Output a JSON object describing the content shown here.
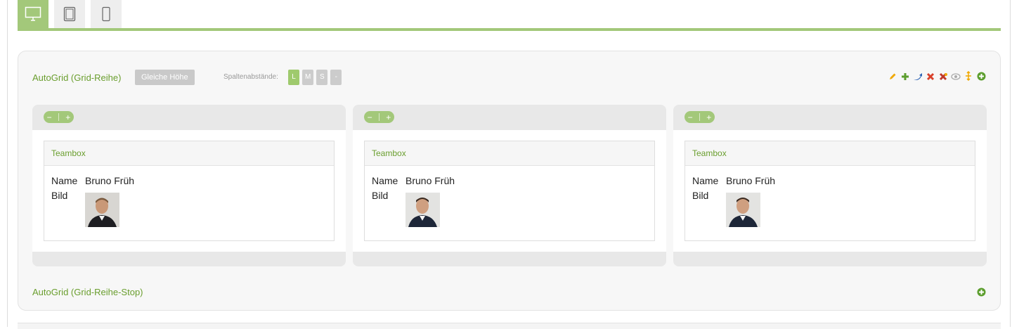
{
  "device_tabs": [
    {
      "name": "desktop-icon",
      "active": true
    },
    {
      "name": "tablet-icon",
      "active": false
    },
    {
      "name": "mobile-icon",
      "active": false
    }
  ],
  "autogrid": {
    "title": "AutoGrid (Grid-Reihe)",
    "equal_height_label": "Gleiche Höhe",
    "gap_label": "Spaltenabstände:",
    "gap_options": [
      {
        "label": "L",
        "active": true
      },
      {
        "label": "M",
        "active": false
      },
      {
        "label": "S",
        "active": false
      },
      {
        "label": "-",
        "active": false
      }
    ],
    "toolbar_icons": [
      "pencil-icon",
      "add-icon",
      "arrow-icon",
      "delete-icon",
      "delete-all-icon",
      "eye-icon",
      "move-icon",
      "add-circle-icon"
    ],
    "stop_title": "AutoGrid (Grid-Reihe-Stop)"
  },
  "columns": [
    {
      "pill_minus": "−",
      "pill_plus": "+",
      "teambox": {
        "title": "Teambox",
        "name_label": "Name",
        "name_value": "Bruno Früh",
        "bild_label": "Bild"
      }
    },
    {
      "pill_minus": "−",
      "pill_plus": "+",
      "teambox": {
        "title": "Teambox",
        "name_label": "Name",
        "name_value": "Bruno Früh",
        "bild_label": "Bild"
      }
    },
    {
      "pill_minus": "−",
      "pill_plus": "+",
      "teambox": {
        "title": "Teambox",
        "name_label": "Name",
        "name_value": "Bruno Früh",
        "bild_label": "Bild"
      }
    }
  ],
  "colors": {
    "accent_green": "#a3c87a",
    "link_green": "#6a9e2e",
    "pencil": "#f0a800",
    "delete_red": "#d9412b",
    "arrow_blue": "#2b62b5"
  }
}
